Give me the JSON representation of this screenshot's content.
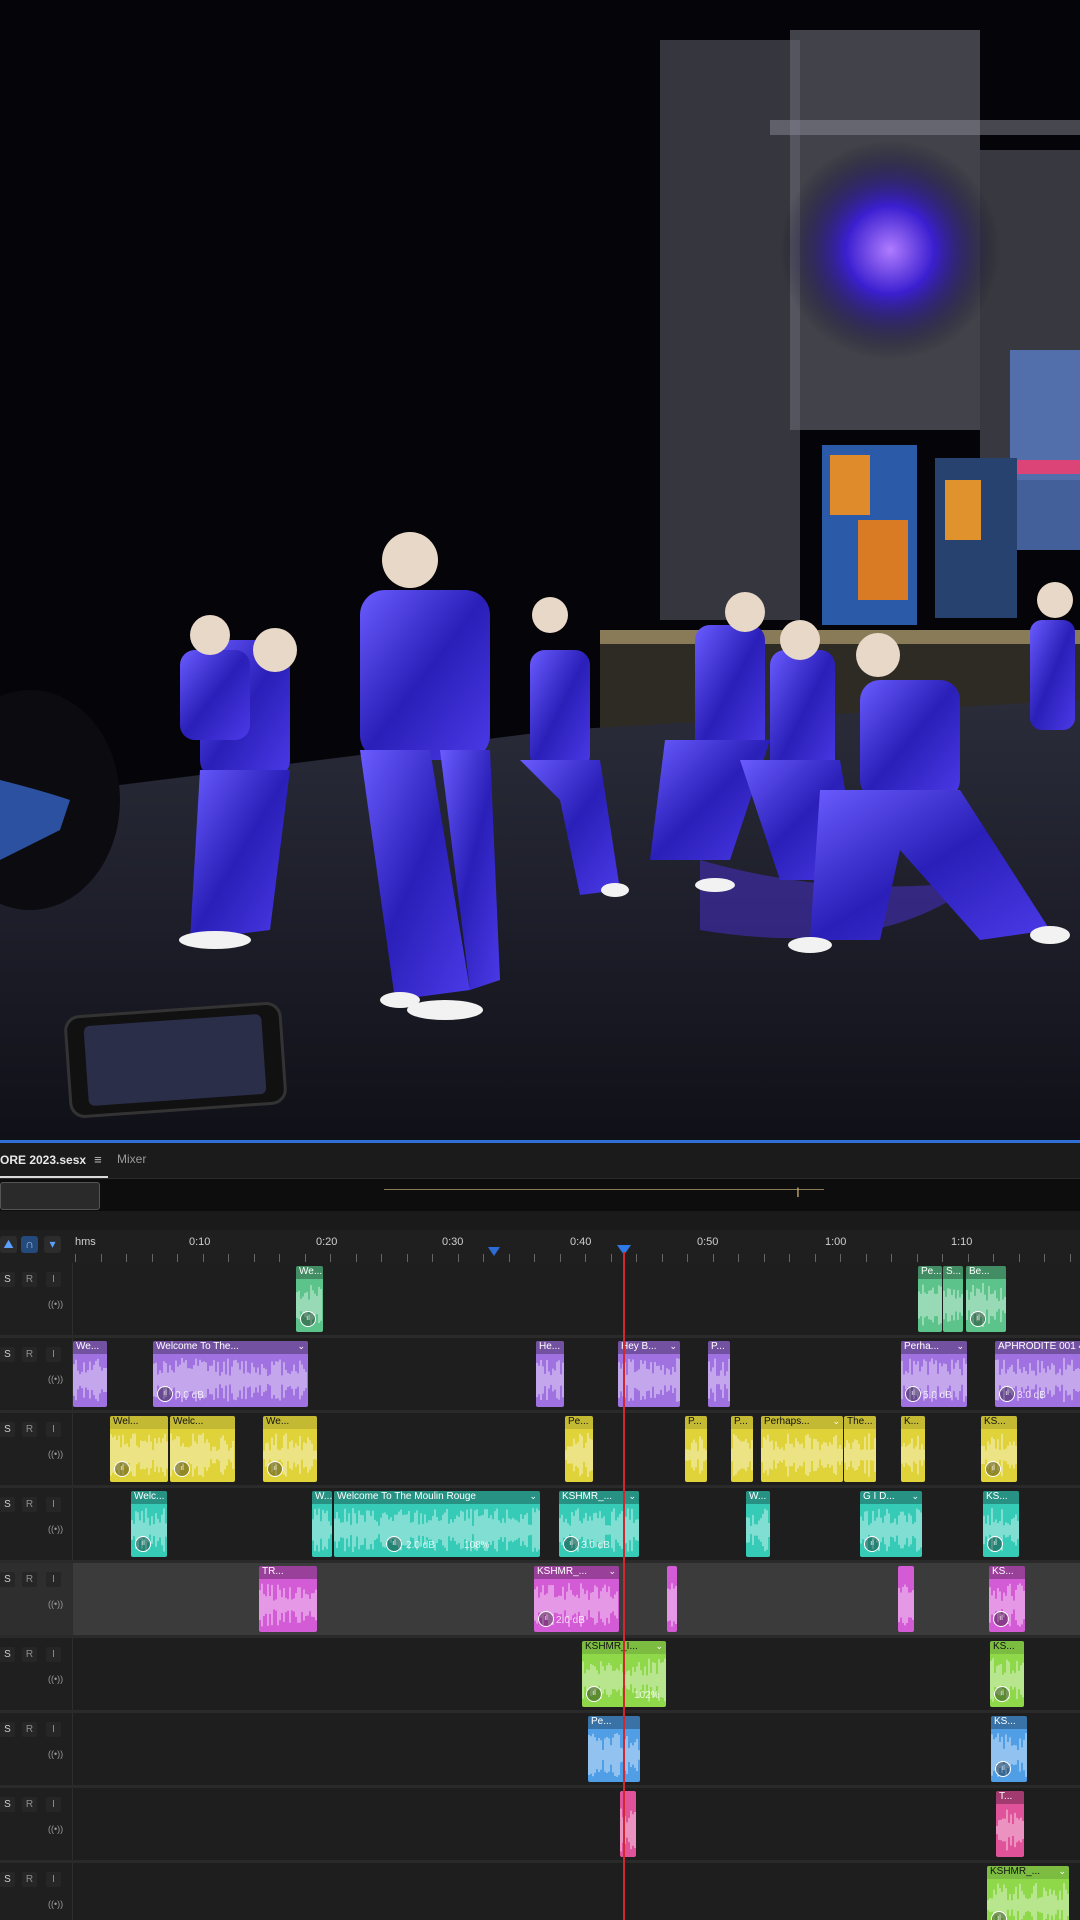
{
  "session": {
    "file_tab_label": "ORE 2023.sesx",
    "mixer_tab_label": "Mixer"
  },
  "ruler": {
    "format_label": "hms",
    "labels": [
      "0:10",
      "0:20",
      "0:30",
      "0:40",
      "0:50",
      "1:00",
      "1:10"
    ]
  },
  "toolbar": {
    "icons": [
      "snap-icon",
      "magnet-icon",
      "marker-icon"
    ]
  },
  "track_buttons": {
    "solo": "S",
    "record": "R",
    "input": "I",
    "output_icon": "((•))"
  },
  "colors": {
    "green": "#5cc48a",
    "purple": "#a071e0",
    "yellow": "#e0d33a",
    "teal": "#36cbb6",
    "magenta": "#d45bd6",
    "lime": "#8ed84a",
    "blue": "#4f9ee6",
    "pink": "#e0529a",
    "playhead": "#d0282e",
    "selected_track_bg": "#3b3b3b"
  },
  "tracks": [
    {
      "color": "green",
      "clips": [
        {
          "title": "We..."
        },
        {
          "title": "Pe..."
        },
        {
          "title": "S..."
        },
        {
          "title": "Be..."
        }
      ]
    },
    {
      "color": "purple",
      "clips": [
        {
          "title": "We..."
        },
        {
          "title": "Welcome To The...",
          "db": "0.0 dB"
        },
        {
          "title": "He..."
        },
        {
          "title": "Hey B..."
        },
        {
          "title": "P..."
        },
        {
          "title": "Perha...",
          "db": "5.0 dB"
        },
        {
          "title": "APHRODITE 001 4",
          "db": "3.0 dB"
        }
      ]
    },
    {
      "color": "yellow",
      "clips": [
        {
          "title": "Wel..."
        },
        {
          "title": "Welc..."
        },
        {
          "title": "We..."
        },
        {
          "title": "Pe..."
        },
        {
          "title": "P..."
        },
        {
          "title": "P..."
        },
        {
          "title": "Perhaps..."
        },
        {
          "title": "The..."
        },
        {
          "title": "K..."
        },
        {
          "title": "KS..."
        }
      ]
    },
    {
      "color": "teal",
      "clips": [
        {
          "title": "Welc..."
        },
        {
          "title": "W..."
        },
        {
          "title": "Welcome To The Moulin Rouge",
          "db": "2.0 dB",
          "stretch": "108%"
        },
        {
          "title": "KSHMR_...",
          "db": "3.0 dB"
        },
        {
          "title": "W..."
        },
        {
          "title": "G I D..."
        },
        {
          "title": "KS..."
        }
      ]
    },
    {
      "color": "magenta",
      "selected": true,
      "clips": [
        {
          "title": "TR..."
        },
        {
          "title": "KSHMR_...",
          "db": "2.0 dB"
        },
        {
          "title": "KS..."
        }
      ]
    },
    {
      "color": "lime",
      "clips": [
        {
          "title": "KSHMR_I...",
          "stretch": "102%"
        },
        {
          "title": "KS..."
        }
      ]
    },
    {
      "color": "blue",
      "clips": [
        {
          "title": "Pe..."
        },
        {
          "title": "KS..."
        }
      ]
    },
    {
      "color": "pink",
      "clips": [
        {
          "title": ""
        },
        {
          "title": "T..."
        }
      ]
    },
    {
      "color": "lime",
      "clips": [
        {
          "title": "KSHMR_..."
        }
      ]
    }
  ]
}
